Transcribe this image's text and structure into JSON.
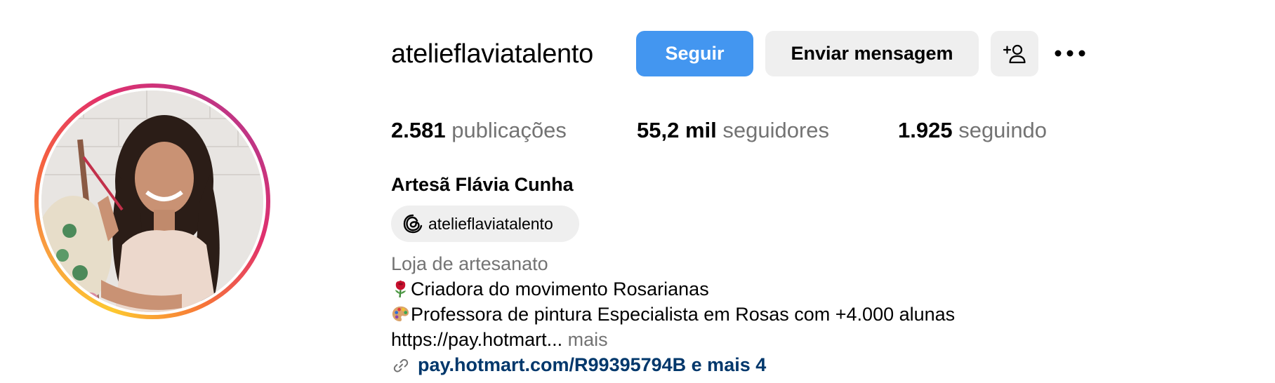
{
  "profile": {
    "username": "atelieflaviatalento",
    "full_name": "Artesã Flávia Cunha",
    "category": "Loja de artesanato"
  },
  "actions": {
    "follow_label": "Seguir",
    "message_label": "Enviar mensagem",
    "suggest_icon": "add-person-icon",
    "more_icon": "more-horizontal-icon"
  },
  "stats": {
    "posts": {
      "value": "2.581",
      "label": "publicações"
    },
    "followers": {
      "value": "55,2 mil",
      "label": "seguidores"
    },
    "following": {
      "value": "1.925",
      "label": "seguindo"
    }
  },
  "threads": {
    "handle": "atelieflaviatalento",
    "icon": "threads-icon"
  },
  "bio": {
    "line1_text": "Criadora do movimento Rosarianas",
    "line1_emoji": "rose-emoji",
    "line2_text": "Professora de pintura Especialista em Rosas com +4.000 alunas",
    "line2_emoji": "palette-emoji",
    "line3_text": "https://pay.hotmart...",
    "more_label": "mais"
  },
  "link": {
    "text": "pay.hotmart.com/R99395794B e mais 4",
    "icon": "link-icon"
  },
  "colors": {
    "follow_button": "#4396f0",
    "secondary_button": "#efefef",
    "muted_text": "#737373",
    "link_text": "#00376b"
  }
}
